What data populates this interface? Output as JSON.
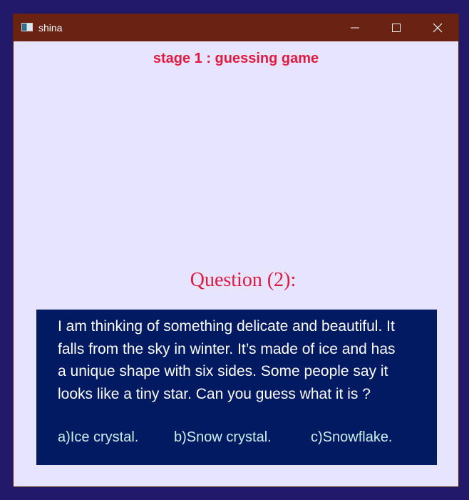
{
  "window": {
    "title": "shina",
    "app_icon": "app-window-icon",
    "controls": {
      "minimize": "minimize-icon",
      "maximize": "maximize-icon",
      "close": "close-icon"
    }
  },
  "game": {
    "stage_title": "stage 1 : guessing game",
    "question_heading": "Question (2):",
    "question_lines": [
      "I am thinking of something delicate and beautiful. It",
      "falls from the sky in winter. It’s made of ice and has",
      "a unique shape with six sides. Some people say it",
      "looks like a tiny star. Can you guess what it is ?"
    ],
    "answers": [
      "a)Ice crystal.",
      "b)Snow crystal.",
      "c)Snowflake."
    ]
  },
  "colors": {
    "desktop": "#23196a",
    "titlebar": "#6a2213",
    "window_bg": "#e6e4fe",
    "accent_red": "#e3193f",
    "panel_bg": "#011a62",
    "answer_text": "#c8f0ea"
  }
}
